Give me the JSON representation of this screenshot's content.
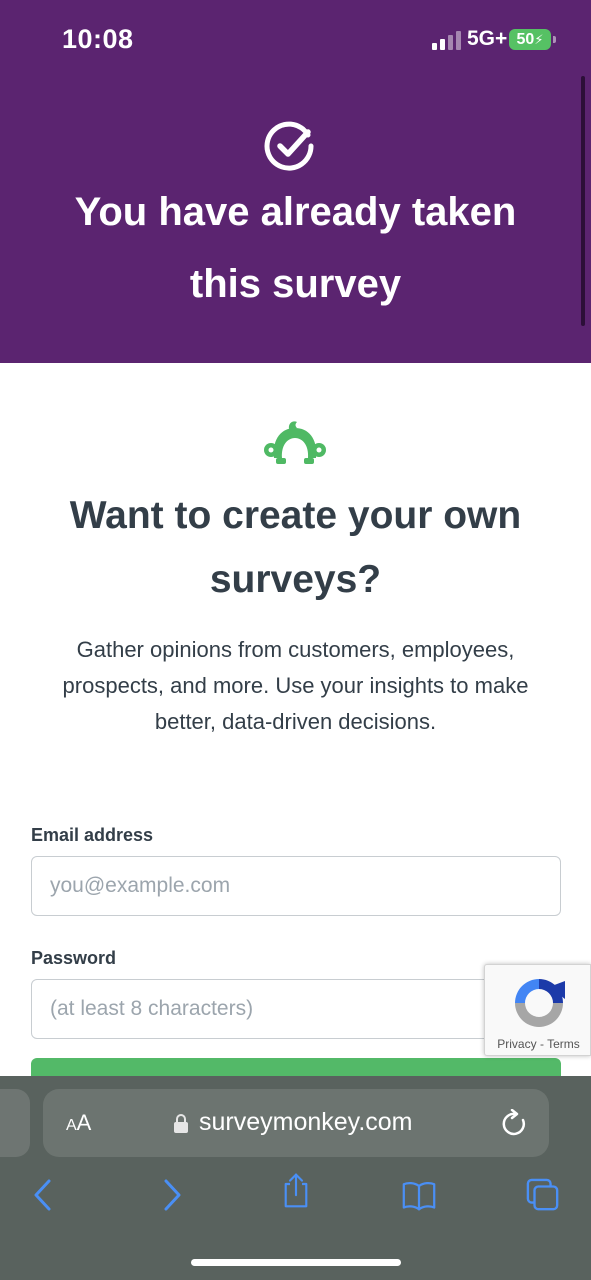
{
  "status_bar": {
    "time": "10:08",
    "network": "5G+",
    "battery": "50"
  },
  "hero": {
    "icon": "check-circle-icon",
    "title": "You have already taken this survey",
    "background_color": "#5b2470"
  },
  "promo": {
    "logo": "surveymonkey-logo-icon",
    "heading": "Want to create your own surveys?",
    "description": "Gather opinions from customers, employees, prospects, and more. Use your insights to make better, data-driven decisions."
  },
  "form": {
    "email_label": "Email address",
    "email_placeholder": "you@example.com",
    "email_value": "",
    "password_label": "Password",
    "password_placeholder": "(at least 8 characters)",
    "password_value": "",
    "button_color": "#53b968"
  },
  "recaptcha": {
    "privacy": "Privacy",
    "separator": "-",
    "terms": "Terms"
  },
  "browser": {
    "text_size_label_small": "A",
    "text_size_label_large": "A",
    "url": "surveymonkey.com",
    "icons": [
      "back-icon",
      "forward-icon",
      "share-icon",
      "bookmarks-icon",
      "tabs-icon"
    ]
  }
}
